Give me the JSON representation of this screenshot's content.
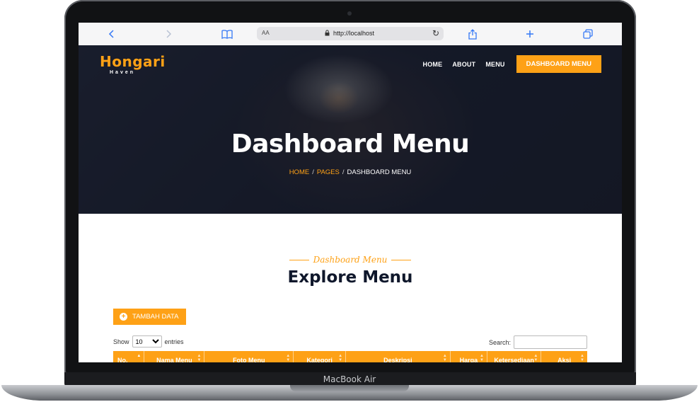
{
  "device": {
    "label": "MacBook Air"
  },
  "browser": {
    "text_size_label": "AA",
    "url": "http://localhost",
    "icons": [
      "back-icon",
      "forward-icon",
      "bookmarks-icon",
      "lock-icon",
      "reload-icon",
      "share-icon",
      "new-tab-icon",
      "tabs-icon"
    ]
  },
  "site": {
    "logo_text": "Hongari",
    "logo_sub": "Haven",
    "nav": [
      "HOME",
      "ABOUT",
      "MENU"
    ],
    "cta": "DASHBOARD MENU",
    "hero_title": "Dashboard Menu",
    "breadcrumb": {
      "home": "HOME",
      "pages": "PAGES",
      "current": "DASHBOARD MENU"
    }
  },
  "section": {
    "subtitle": "Dashboard Menu",
    "title": "Explore Menu",
    "add_button": "TAMBAH DATA",
    "show_label": "Show",
    "entries_value": "10",
    "entries_label": "entries",
    "search_label": "Search:"
  },
  "table": {
    "columns": [
      "No.",
      "Nama Menu",
      "Foto Menu",
      "Kategori",
      "Deskripsi",
      "Harga",
      "Ketersediaan",
      "Aksi"
    ]
  },
  "colors": {
    "accent": "#fea116",
    "dark": "#0f172b"
  }
}
